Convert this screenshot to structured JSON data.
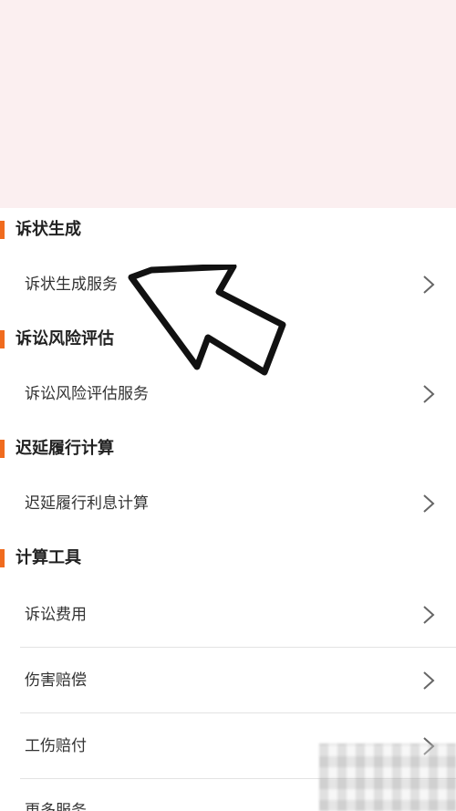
{
  "sections": [
    {
      "title": "诉状生成",
      "items": [
        "诉状生成服务"
      ]
    },
    {
      "title": "诉讼风险评估",
      "items": [
        "诉讼风险评估服务"
      ]
    },
    {
      "title": "迟延履行计算",
      "items": [
        "迟延履行利息计算"
      ]
    },
    {
      "title": "计算工具",
      "items": [
        "诉讼费用",
        "伤害赔偿",
        "工伤赔付",
        "更多服务"
      ]
    }
  ],
  "colors": {
    "accent": "#f06b1e",
    "banner": "#fbeff0"
  },
  "icons": {
    "chevron": "chevron-right-icon",
    "annotation": "annotation-arrow-icon"
  }
}
